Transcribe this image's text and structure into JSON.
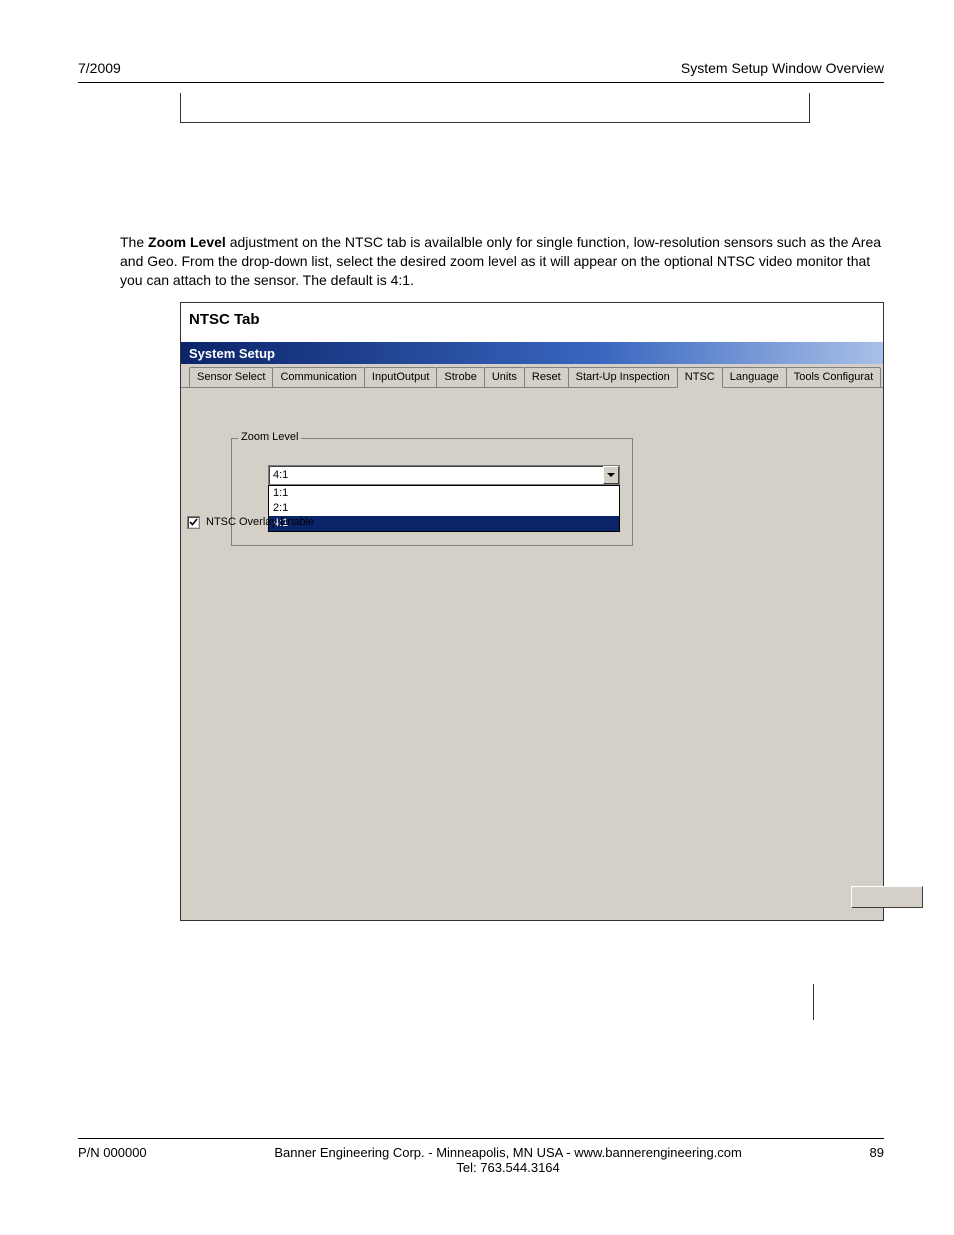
{
  "header": {
    "left": "7/2009",
    "right": "System Setup Window Overview"
  },
  "paragraph": {
    "bold_lead": "Zoom Level",
    "text_after_bold": " adjustment on the NTSC tab is availalble only for single function, low-resolution sensors such as the Area and Geo. From the drop-down list, select the desired zoom level as it will appear on the optional NTSC video monitor that you can attach to the sensor. The default is 4:1.",
    "prefix": "The "
  },
  "figure": {
    "title": "NTSC Tab",
    "window_title": "System Setup",
    "tabs": [
      "Sensor Select",
      "Communication",
      "InputOutput",
      "Strobe",
      "Units",
      "Reset",
      "Start-Up Inspection",
      "NTSC",
      "Language",
      "Tools Configurat"
    ],
    "active_tab_index": 7,
    "groupbox_legend": "Zoom Level",
    "combo_value": "4:1",
    "combo_options": [
      "1:1",
      "2:1",
      "4:1"
    ],
    "combo_highlight_index": 2,
    "checkbox_label": "NTSC Overlay Enable",
    "checkbox_checked": true
  },
  "footer": {
    "left": "P/N 000000",
    "center_line1": "Banner Engineering Corp. - Minneapolis, MN USA - www.bannerengineering.com",
    "center_line2": "Tel: 763.544.3164",
    "right": "89"
  }
}
